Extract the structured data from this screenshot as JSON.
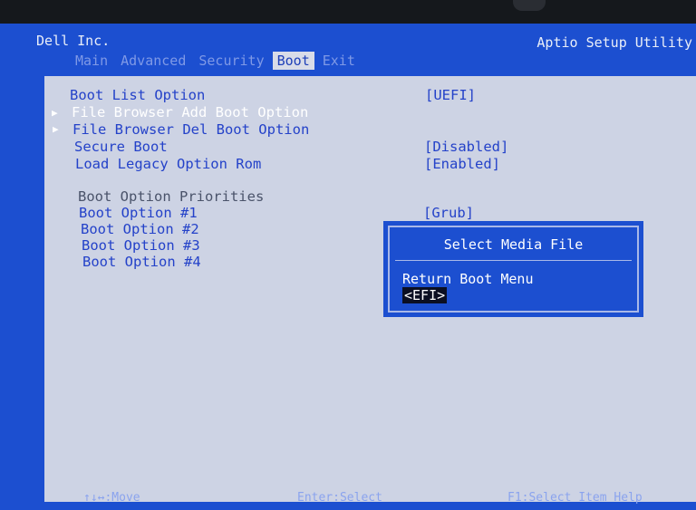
{
  "header": {
    "vendor": "Dell Inc.",
    "utility": "Aptio Setup Utility"
  },
  "tabs": [
    "Main",
    "Advanced",
    "Security",
    "Boot",
    "Exit"
  ],
  "active_tab": "Boot",
  "menu": [
    {
      "label": "Boot List Option",
      "value": "[UEFI]"
    },
    {
      "label": "File Browser Add Boot Option",
      "value": ""
    },
    {
      "label": "File Browser Del Boot Option",
      "value": ""
    },
    {
      "label": "Secure Boot",
      "value": "[Disabled]"
    },
    {
      "label": "Load Legacy Option Rom",
      "value": "[Enabled]"
    },
    {
      "label": "Boot Option Priorities",
      "value": ""
    },
    {
      "label": "Boot Option #1",
      "value": "[Grub]"
    },
    {
      "label": "Boot Option #2",
      "value": ""
    },
    {
      "label": "Boot Option #3",
      "value": ""
    },
    {
      "label": "Boot Option #4",
      "value": ""
    }
  ],
  "dialog": {
    "title": "Select Media File",
    "items": [
      "Return Boot Menu",
      "<EFI>"
    ],
    "selected": "<EFI>"
  },
  "footer": {
    "move": "↑↓↔:Move",
    "select": "Enter:Select",
    "help": "F1:Select Item Help"
  },
  "icons": [
    "submenu-arrow-icon"
  ]
}
